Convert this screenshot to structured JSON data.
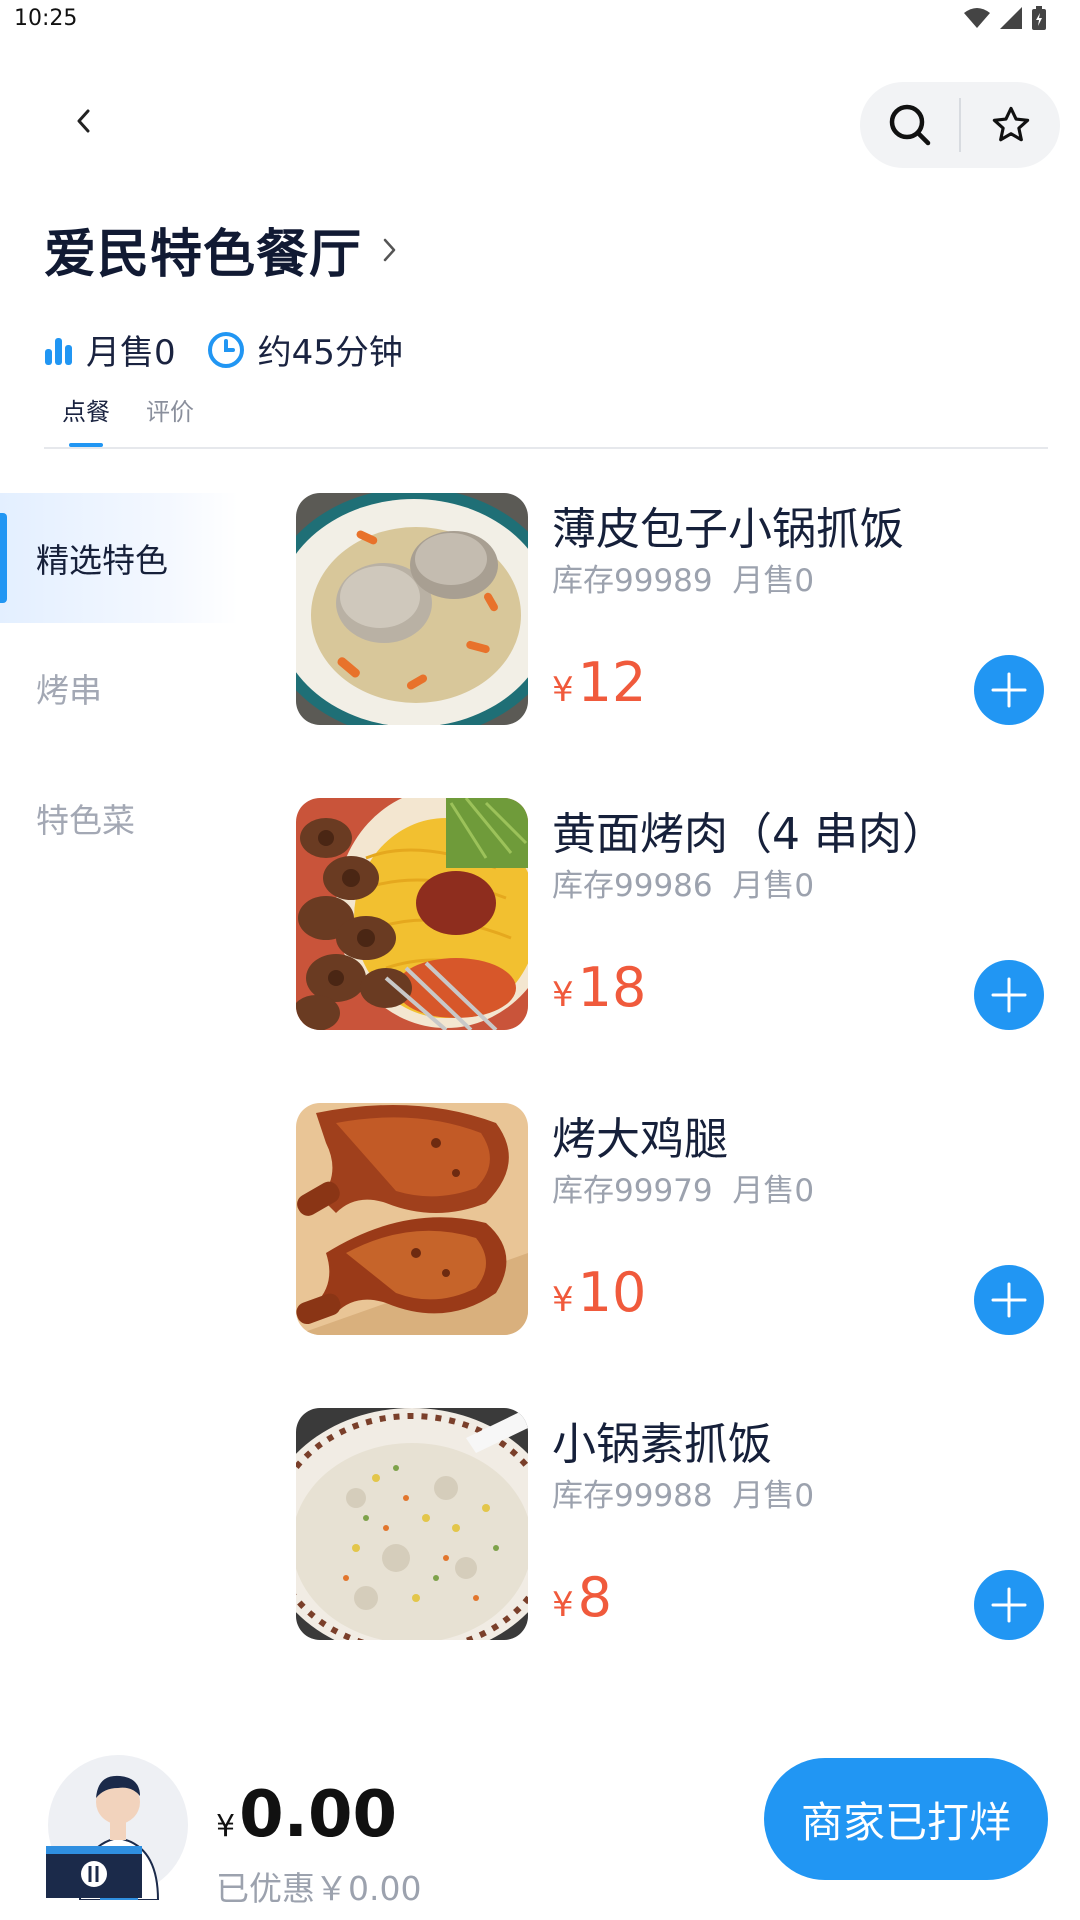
{
  "status_bar": {
    "time": "10:25"
  },
  "store": {
    "name": "爱民特色餐厅",
    "monthly_sales": "月售0",
    "delivery_time": "约45分钟"
  },
  "tabs": [
    {
      "label": "点餐",
      "active": true
    },
    {
      "label": "评价",
      "active": false
    }
  ],
  "categories": [
    {
      "label": "精选特色",
      "active": true
    },
    {
      "label": "烤串",
      "active": false
    },
    {
      "label": "特色菜",
      "active": false
    }
  ],
  "dishes": [
    {
      "name": "薄皮包子小锅抓饭",
      "stock": "库存99989",
      "sales": "月售0",
      "currency": "¥",
      "price": "12",
      "photo": "dumplings-pilaf-photo"
    },
    {
      "name": "黄面烤肉（4 串肉）",
      "stock": "库存99986",
      "sales": "月售0",
      "currency": "¥",
      "price": "18",
      "photo": "noodles-kebab-photo"
    },
    {
      "name": "烤大鸡腿",
      "stock": "库存99979",
      "sales": "月售0",
      "currency": "¥",
      "price": "10",
      "photo": "roast-chicken-leg-photo"
    },
    {
      "name": "小锅素抓饭",
      "stock": "库存99988",
      "sales": "月售0",
      "currency": "¥",
      "price": "8",
      "photo": "vegetable-pilaf-photo"
    }
  ],
  "cart": {
    "currency": "¥",
    "total": "0.00",
    "discount_label": "已优惠￥0.00"
  },
  "checkout_label": "商家已打烊",
  "colors": {
    "accent": "#2196f3",
    "price": "#f05a3c",
    "muted": "#9ca2ae",
    "text": "#16203a"
  },
  "icons": [
    "back-icon",
    "search-icon",
    "star-icon",
    "chevron-right-icon",
    "sales-chart-icon",
    "clock-icon",
    "plus-icon",
    "wifi-icon",
    "signal-icon",
    "battery-icon"
  ]
}
